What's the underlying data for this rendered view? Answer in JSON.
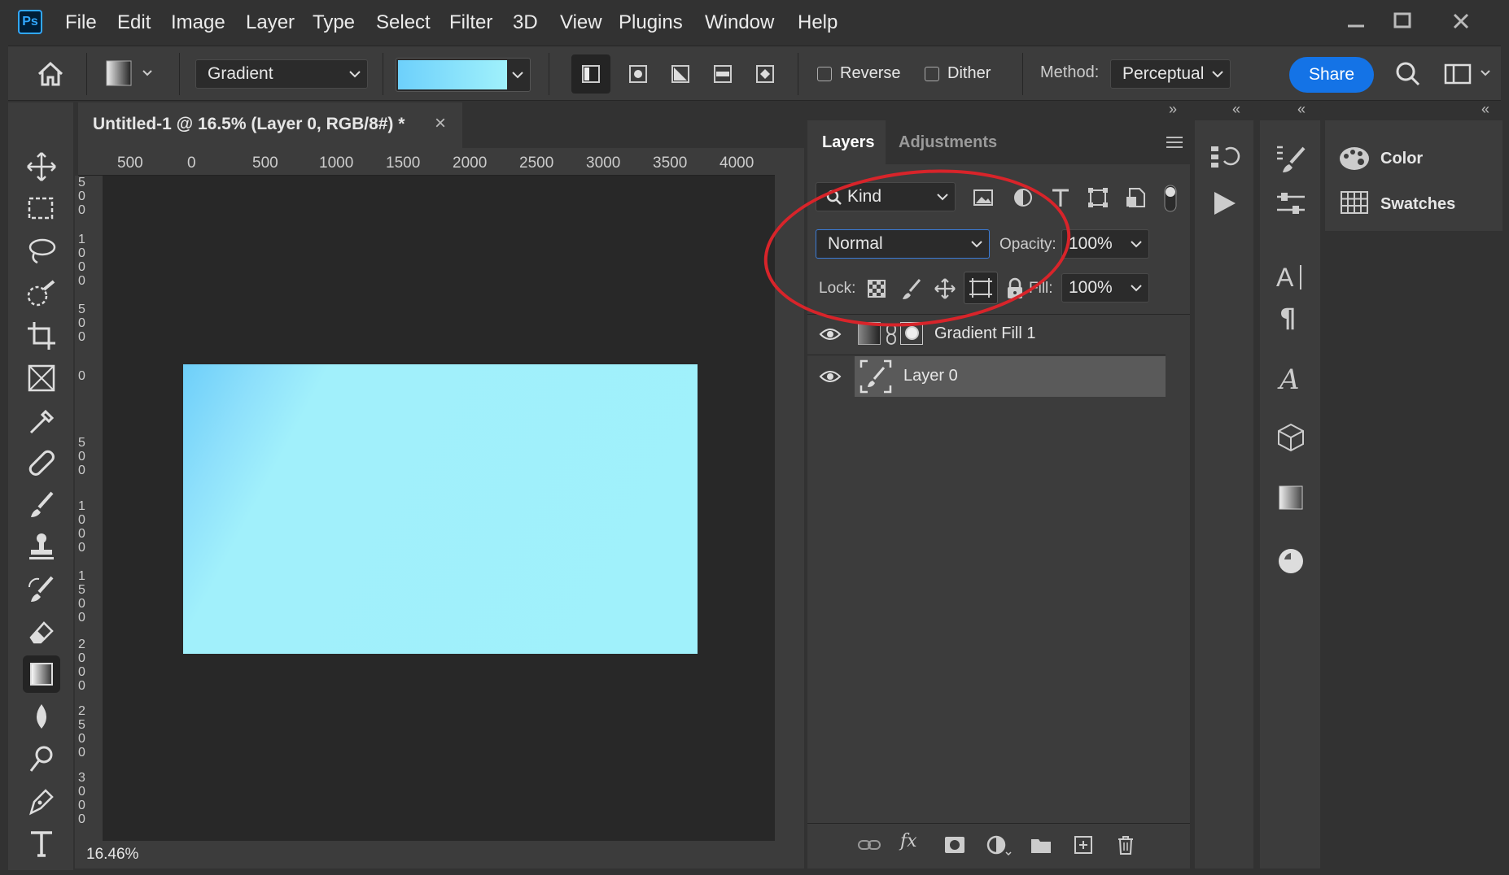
{
  "app": {
    "logo": "Ps"
  },
  "menu": [
    "File",
    "Edit",
    "Image",
    "Layer",
    "Type",
    "Select",
    "Filter",
    "3D",
    "View",
    "Plugins",
    "Window",
    "Help"
  ],
  "options": {
    "preset_label": "Gradient",
    "reverse_label": "Reverse",
    "dither_label": "Dither",
    "method_label": "Method:",
    "method_value": "Perceptual",
    "share_label": "Share",
    "gradient_colors": [
      "#6dd0fb",
      "#a0f1fb"
    ]
  },
  "document": {
    "tab_title": "Untitled-1 @ 16.5% (Layer 0, RGB/8#) *",
    "close_glyph": "×",
    "zoom": "16.46%",
    "ruler_top": [
      "500",
      "0",
      "500",
      "1000",
      "1500",
      "2000",
      "2500",
      "3000",
      "3500",
      "4000"
    ],
    "ruler_left": [
      "5\n0\n0",
      "1\n0\n0\n0",
      "5\n0\n0",
      "0",
      "5\n0\n0",
      "1\n0\n0\n0",
      "1\n5\n0\n0",
      "2\n0\n0\n0",
      "2\n5\n0\n0",
      "3\n0\n0\n0"
    ]
  },
  "layers_panel": {
    "tabs": [
      "Layers",
      "Adjustments"
    ],
    "filter_kind": "Kind",
    "blend_mode": "Normal",
    "opacity_label": "Opacity:",
    "opacity_value": "100%",
    "lock_label": "Lock:",
    "fill_label": "Fill:",
    "fill_value": "100%",
    "layers": [
      {
        "name": "Gradient Fill 1",
        "visible": true,
        "selected": false
      },
      {
        "name": "Layer 0",
        "visible": true,
        "selected": true
      }
    ]
  },
  "side_panels": {
    "color_label": "Color",
    "swatches_label": "Swatches"
  },
  "collapse": {
    "left": "»",
    "right": "«"
  },
  "colors": {
    "accent": "#1473e6",
    "annotation": "#d8242a",
    "bg": "#323232",
    "panel": "#3c3c3c"
  }
}
